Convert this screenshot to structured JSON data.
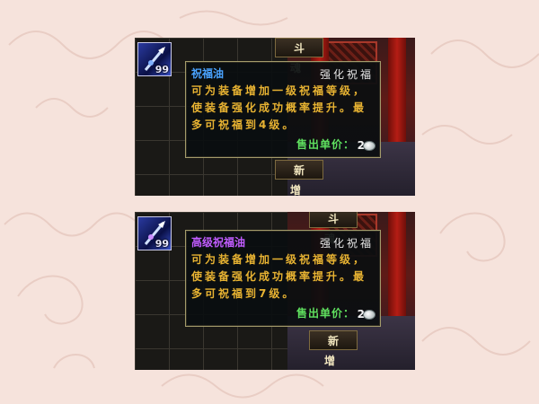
{
  "screens": [
    {
      "slot": {
        "count": "99"
      },
      "tab_label": "斗 魂",
      "tooltip": {
        "item_name": "祝福油",
        "item_name_color": "#4aa3ff",
        "item_type": "强化祝福",
        "description": "可为装备增加一级祝福等级，使装备强化成功概率提升。最多可祝福到4级。",
        "price_label": "售出单价：",
        "price_value": "2",
        "price_icon": "silver-coin-icon"
      },
      "button_label": "新 增"
    },
    {
      "slot": {
        "count": "99"
      },
      "tab_label": "斗 魂",
      "tooltip": {
        "item_name": "高级祝福油",
        "item_name_color": "#c15cff",
        "item_type": "强化祝福",
        "description": "可为装备增加一级祝福等级，使装备强化成功概率提升。最多可祝福到7级。",
        "price_label": "售出单价：",
        "price_value": "2",
        "price_icon": "silver-coin-icon"
      },
      "button_label": "新 增"
    }
  ],
  "colors": {
    "accent_gold": "#e8b332",
    "price_green": "#5fe05f",
    "tooltip_border": "#a39b6b"
  }
}
